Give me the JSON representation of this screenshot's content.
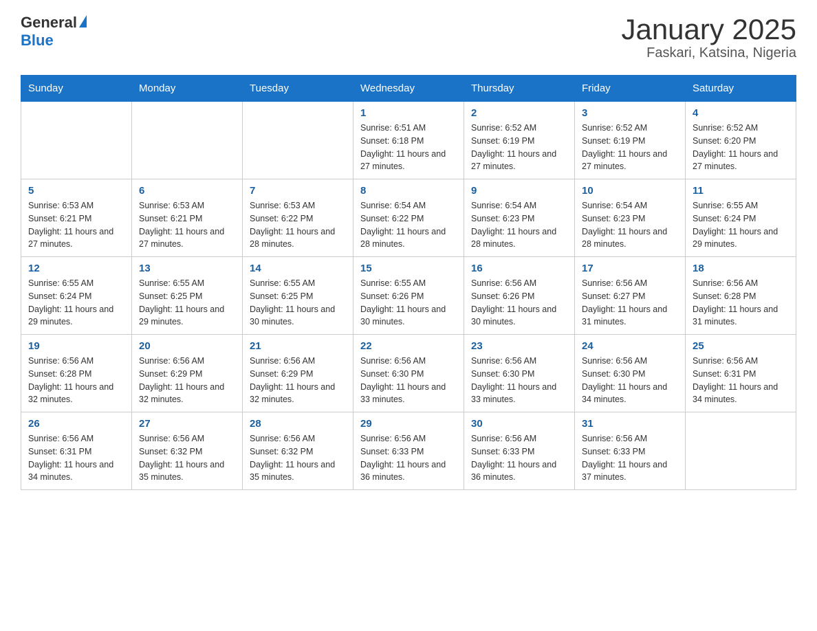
{
  "logo": {
    "general": "General",
    "blue": "Blue"
  },
  "title": "January 2025",
  "subtitle": "Faskari, Katsina, Nigeria",
  "days_of_week": [
    "Sunday",
    "Monday",
    "Tuesday",
    "Wednesday",
    "Thursday",
    "Friday",
    "Saturday"
  ],
  "weeks": [
    [
      {
        "day": "",
        "info": ""
      },
      {
        "day": "",
        "info": ""
      },
      {
        "day": "",
        "info": ""
      },
      {
        "day": "1",
        "info": "Sunrise: 6:51 AM\nSunset: 6:18 PM\nDaylight: 11 hours and 27 minutes."
      },
      {
        "day": "2",
        "info": "Sunrise: 6:52 AM\nSunset: 6:19 PM\nDaylight: 11 hours and 27 minutes."
      },
      {
        "day": "3",
        "info": "Sunrise: 6:52 AM\nSunset: 6:19 PM\nDaylight: 11 hours and 27 minutes."
      },
      {
        "day": "4",
        "info": "Sunrise: 6:52 AM\nSunset: 6:20 PM\nDaylight: 11 hours and 27 minutes."
      }
    ],
    [
      {
        "day": "5",
        "info": "Sunrise: 6:53 AM\nSunset: 6:21 PM\nDaylight: 11 hours and 27 minutes."
      },
      {
        "day": "6",
        "info": "Sunrise: 6:53 AM\nSunset: 6:21 PM\nDaylight: 11 hours and 27 minutes."
      },
      {
        "day": "7",
        "info": "Sunrise: 6:53 AM\nSunset: 6:22 PM\nDaylight: 11 hours and 28 minutes."
      },
      {
        "day": "8",
        "info": "Sunrise: 6:54 AM\nSunset: 6:22 PM\nDaylight: 11 hours and 28 minutes."
      },
      {
        "day": "9",
        "info": "Sunrise: 6:54 AM\nSunset: 6:23 PM\nDaylight: 11 hours and 28 minutes."
      },
      {
        "day": "10",
        "info": "Sunrise: 6:54 AM\nSunset: 6:23 PM\nDaylight: 11 hours and 28 minutes."
      },
      {
        "day": "11",
        "info": "Sunrise: 6:55 AM\nSunset: 6:24 PM\nDaylight: 11 hours and 29 minutes."
      }
    ],
    [
      {
        "day": "12",
        "info": "Sunrise: 6:55 AM\nSunset: 6:24 PM\nDaylight: 11 hours and 29 minutes."
      },
      {
        "day": "13",
        "info": "Sunrise: 6:55 AM\nSunset: 6:25 PM\nDaylight: 11 hours and 29 minutes."
      },
      {
        "day": "14",
        "info": "Sunrise: 6:55 AM\nSunset: 6:25 PM\nDaylight: 11 hours and 30 minutes."
      },
      {
        "day": "15",
        "info": "Sunrise: 6:55 AM\nSunset: 6:26 PM\nDaylight: 11 hours and 30 minutes."
      },
      {
        "day": "16",
        "info": "Sunrise: 6:56 AM\nSunset: 6:26 PM\nDaylight: 11 hours and 30 minutes."
      },
      {
        "day": "17",
        "info": "Sunrise: 6:56 AM\nSunset: 6:27 PM\nDaylight: 11 hours and 31 minutes."
      },
      {
        "day": "18",
        "info": "Sunrise: 6:56 AM\nSunset: 6:28 PM\nDaylight: 11 hours and 31 minutes."
      }
    ],
    [
      {
        "day": "19",
        "info": "Sunrise: 6:56 AM\nSunset: 6:28 PM\nDaylight: 11 hours and 32 minutes."
      },
      {
        "day": "20",
        "info": "Sunrise: 6:56 AM\nSunset: 6:29 PM\nDaylight: 11 hours and 32 minutes."
      },
      {
        "day": "21",
        "info": "Sunrise: 6:56 AM\nSunset: 6:29 PM\nDaylight: 11 hours and 32 minutes."
      },
      {
        "day": "22",
        "info": "Sunrise: 6:56 AM\nSunset: 6:30 PM\nDaylight: 11 hours and 33 minutes."
      },
      {
        "day": "23",
        "info": "Sunrise: 6:56 AM\nSunset: 6:30 PM\nDaylight: 11 hours and 33 minutes."
      },
      {
        "day": "24",
        "info": "Sunrise: 6:56 AM\nSunset: 6:30 PM\nDaylight: 11 hours and 34 minutes."
      },
      {
        "day": "25",
        "info": "Sunrise: 6:56 AM\nSunset: 6:31 PM\nDaylight: 11 hours and 34 minutes."
      }
    ],
    [
      {
        "day": "26",
        "info": "Sunrise: 6:56 AM\nSunset: 6:31 PM\nDaylight: 11 hours and 34 minutes."
      },
      {
        "day": "27",
        "info": "Sunrise: 6:56 AM\nSunset: 6:32 PM\nDaylight: 11 hours and 35 minutes."
      },
      {
        "day": "28",
        "info": "Sunrise: 6:56 AM\nSunset: 6:32 PM\nDaylight: 11 hours and 35 minutes."
      },
      {
        "day": "29",
        "info": "Sunrise: 6:56 AM\nSunset: 6:33 PM\nDaylight: 11 hours and 36 minutes."
      },
      {
        "day": "30",
        "info": "Sunrise: 6:56 AM\nSunset: 6:33 PM\nDaylight: 11 hours and 36 minutes."
      },
      {
        "day": "31",
        "info": "Sunrise: 6:56 AM\nSunset: 6:33 PM\nDaylight: 11 hours and 37 minutes."
      },
      {
        "day": "",
        "info": ""
      }
    ]
  ],
  "colors": {
    "header_bg": "#1a73c7",
    "header_text": "#ffffff",
    "day_number_color": "#1a5fa0"
  }
}
